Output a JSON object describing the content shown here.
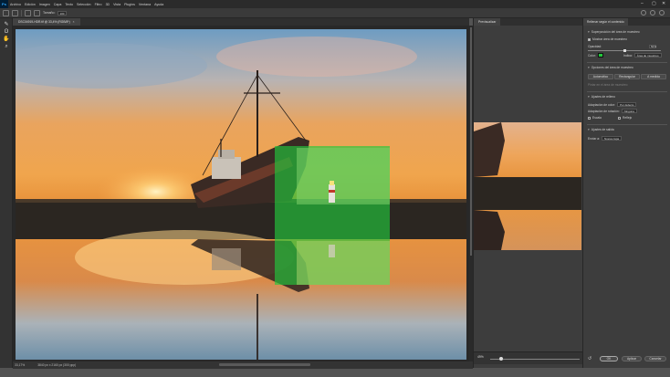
{
  "app": {
    "logo": "Ps",
    "menu": [
      "Archivo",
      "Edición",
      "Imagen",
      "Capa",
      "Texto",
      "Selección",
      "Filtro",
      "3D",
      "Vista",
      "Plugins",
      "Ventana",
      "Ayuda"
    ]
  },
  "options_bar": {
    "size_label": "Tamaño:",
    "size_value": "100"
  },
  "document": {
    "tab_title": "DSC04919-HDR.tif @ 33,4% (RGB/8*)",
    "close": "×",
    "zoom": "33,17%",
    "dimensions": "3840 px x 2160 px (300 ppp)"
  },
  "preview": {
    "tab": "Previsualizar",
    "zoom": "49%"
  },
  "fill_panel": {
    "tab": "Rellenar según el contenido",
    "sampling_overlay": "Superposición del área de muestreo",
    "show_sampling_area": "Mostrar área de muestreo",
    "opacity_label": "Opacidad:",
    "opacity_value": "50%",
    "color_label": "Color:",
    "indicates_label": "Indica:",
    "indicates_value": "Área de muestreo",
    "sampling_options": "Opciones del área de muestreo",
    "automatic": "Automático",
    "rectangular": "Rectangular",
    "custom": "A medida",
    "hint": "Pintar en el área de muestreo",
    "fill_settings": "Ajustes de relleno",
    "color_adaptation_label": "Adaptación de color:",
    "color_adaptation_value": "Por defecto",
    "rotation_adaptation_label": "Adaptación de rotación:",
    "rotation_adaptation_value": "Ninguna",
    "scale": "Escala",
    "mirror": "Reflejo",
    "output_settings": "Ajustes de salida",
    "output_to_label": "Enviar a:",
    "output_to_value": "Nueva capa",
    "ok": "OK",
    "apply": "Aplicar",
    "cancel": "Cancelar"
  },
  "colors": {
    "sampling_overlay": "#22c83c",
    "canvas_bg": "#282828",
    "panel_bg": "#3d3d3d"
  }
}
